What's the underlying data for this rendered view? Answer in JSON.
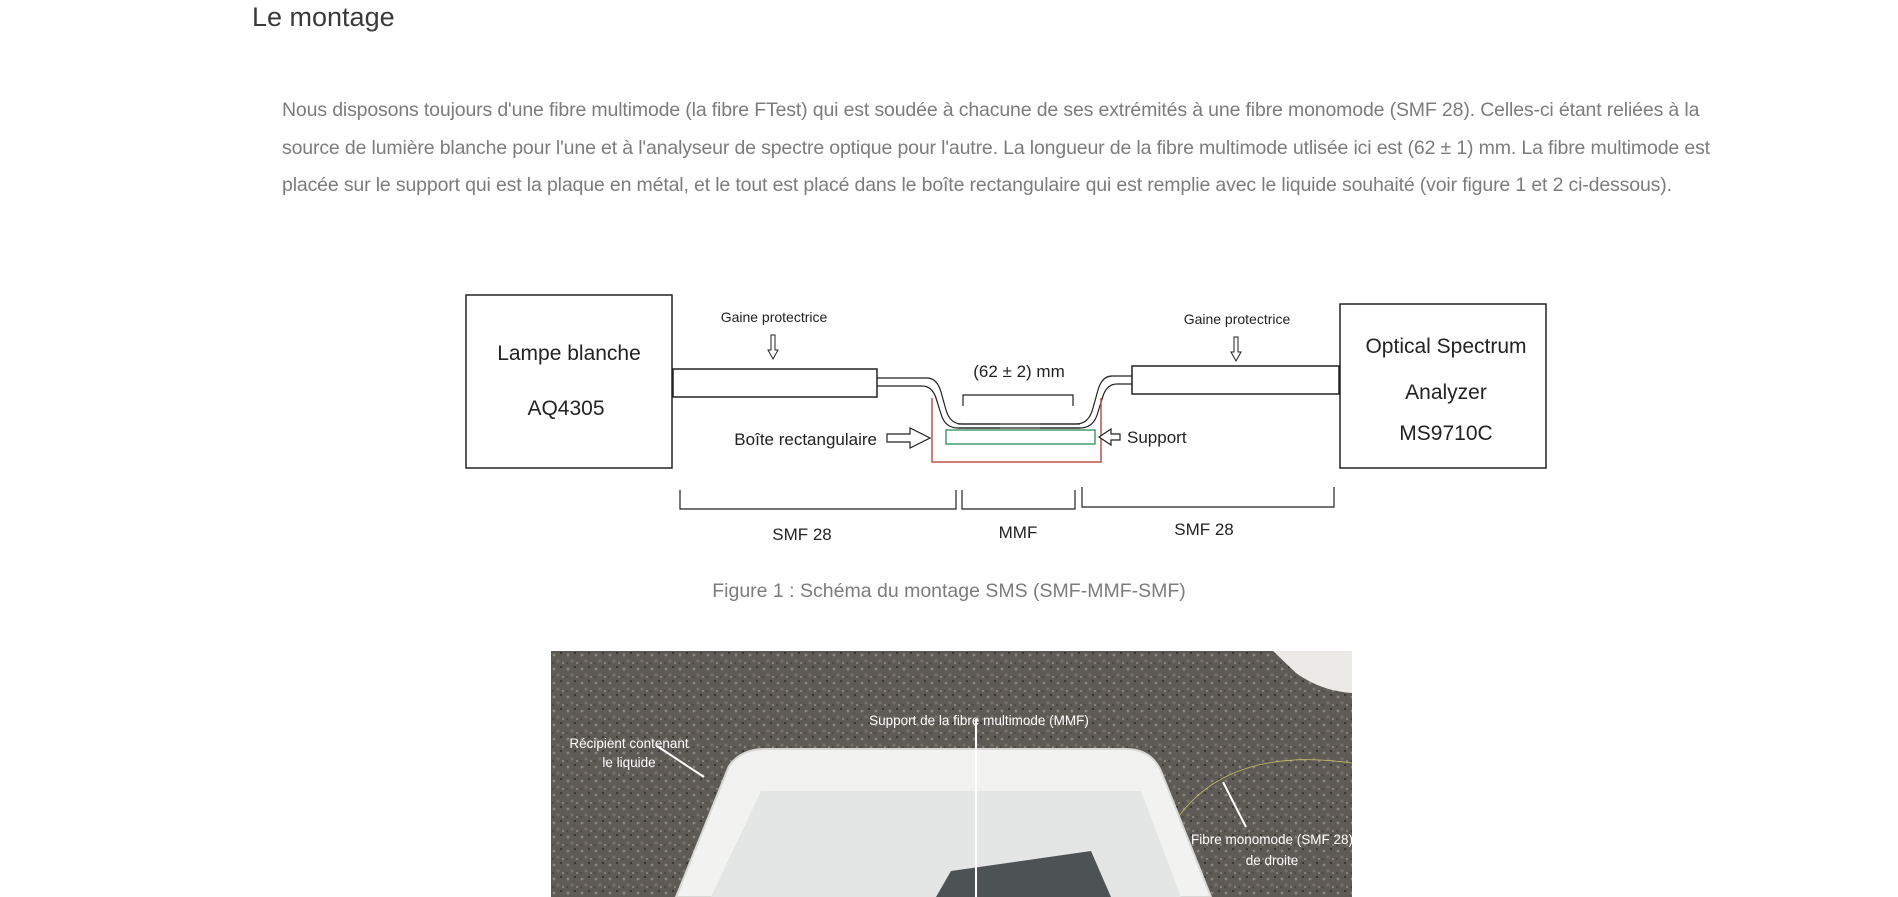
{
  "section": {
    "title": "Le montage"
  },
  "paragraph": {
    "lines": [
      "Nous disposons toujours d'une fibre multimode (la fibre FTest) qui est soudée à chacune de ses extrémités à une fibre monomode (SMF 28). Celles-ci étant reliées à la",
      "source de lumière blanche pour l'une et à l'analyseur de spectre optique pour l'autre. La longueur de la fibre multimode utlisée ici est (62 ± 1) mm. La fibre multimode est",
      "placée sur le support qui est la plaque en métal, et le tout est placé dans le boîte rectangulaire qui est remplie avec le liquide souhaité (voir figure 1 et 2 ci-dessous)."
    ]
  },
  "figure1": {
    "lamp_line1": "Lampe blanche",
    "lamp_line2": "AQ4305",
    "osa_line1": "Optical Spectrum",
    "osa_line2": "Analyzer",
    "osa_line3": "MS9710C",
    "sheath_left": "Gaine protectrice",
    "sheath_right": "Gaine protectrice",
    "length": "(62 ± 2) mm",
    "box_label": "Boîte rectangulaire",
    "support_label": "Support",
    "seg_left": "SMF 28",
    "seg_mid": "MMF",
    "seg_right": "SMF 28",
    "caption": "Figure 1 : Schéma du montage SMS (SMF-MMF-SMF)"
  },
  "figure2": {
    "label_container_1": "Récipient contenant",
    "label_container_2": "le liquide",
    "label_support": "Support de la fibre multimode (MMF)",
    "label_fiber_1": "Fibre monomode (SMF 28)",
    "label_fiber_2": "de droite"
  }
}
